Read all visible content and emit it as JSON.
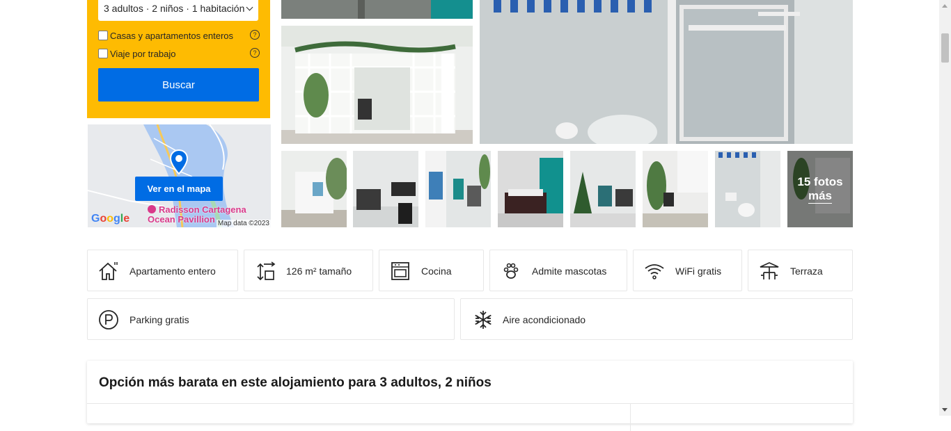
{
  "search": {
    "occupancy": "3 adultos · 2 niños · 1 habitación",
    "checkbox_homes": "Casas y apartamentos enteros",
    "checkbox_work": "Viaje por trabajo",
    "help_glyph": "?",
    "button": "Buscar"
  },
  "map": {
    "button": "Ver en el mapa",
    "poi_line1": "Radisson Cartagena",
    "poi_line2": "Ocean Pavillion",
    "google": "Google",
    "copyright": "Map data ©2023"
  },
  "gallery": {
    "more_line1": "15 fotos",
    "more_line2": "más"
  },
  "facilities": [
    {
      "label": "Apartamento entero",
      "icon": "house-icon"
    },
    {
      "label": "126 m² tamaño",
      "icon": "size-icon"
    },
    {
      "label": "Cocina",
      "icon": "oven-icon"
    },
    {
      "label": "Admite mascotas",
      "icon": "paw-icon"
    },
    {
      "label": "WiFi gratis",
      "icon": "wifi-icon"
    },
    {
      "label": "Terraza",
      "icon": "terrace-icon"
    },
    {
      "label": "Parking gratis",
      "icon": "parking-icon"
    },
    {
      "label": "Aire acondicionado",
      "icon": "snowflake-icon"
    }
  ],
  "cheapest": {
    "title": "Opción más barata en este alojamiento para 3 adultos, 2 niños"
  },
  "colors": {
    "brand_yellow": "#febb02",
    "brand_blue": "#006ce4"
  }
}
